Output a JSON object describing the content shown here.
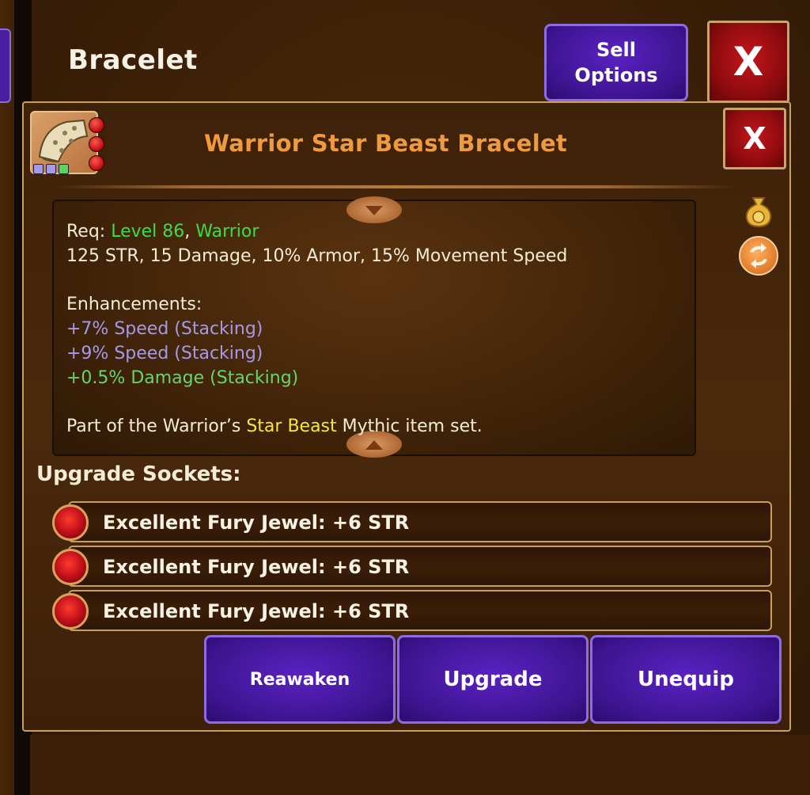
{
  "header": {
    "title": "Bracelet",
    "sell_options_line1": "Sell",
    "sell_options_line2": "Options",
    "close_label": "X"
  },
  "item": {
    "name": "Warrior Star Beast Bracelet",
    "close_label": "X",
    "req_label": "Req: ",
    "req_level": "Level 86",
    "req_sep": ", ",
    "req_class": "Warrior",
    "stats": "125 STR, 15 Damage, 10% Armor, 15% Movement Speed",
    "enhancements_title": "Enhancements:",
    "enhancements": [
      {
        "text": "+7% Speed (Stacking)",
        "color": "#a69ae8"
      },
      {
        "text": "+9% Speed (Stacking)",
        "color": "#a69ae8"
      },
      {
        "text": "+0.5% Damage (Stacking)",
        "color": "#66d66a"
      }
    ],
    "set_prefix": "Part of the Warrior’s ",
    "set_name": "Star Beast",
    "set_suffix": " Mythic item set.",
    "gem_slots": 3,
    "slot_colors": [
      "#a59ae6",
      "#a59ae6",
      "#5ad45e"
    ]
  },
  "sockets": {
    "title": "Upgrade Sockets:",
    "items": [
      {
        "label": "Excellent Fury Jewel: +6 STR"
      },
      {
        "label": "Excellent Fury Jewel: +6 STR"
      },
      {
        "label": "Excellent Fury Jewel: +6 STR"
      }
    ]
  },
  "actions": {
    "reawaken": "Reawaken",
    "upgrade": "Upgrade",
    "unequip": "Unequip"
  },
  "side_icons": [
    "gold-bag-icon",
    "swap-icon"
  ],
  "colors": {
    "item_name": "#f09a3e",
    "req_green": "#3ddc48",
    "set_yellow": "#f5e83a",
    "button_purple": "#4a1aa8",
    "close_red": "#b01216"
  }
}
